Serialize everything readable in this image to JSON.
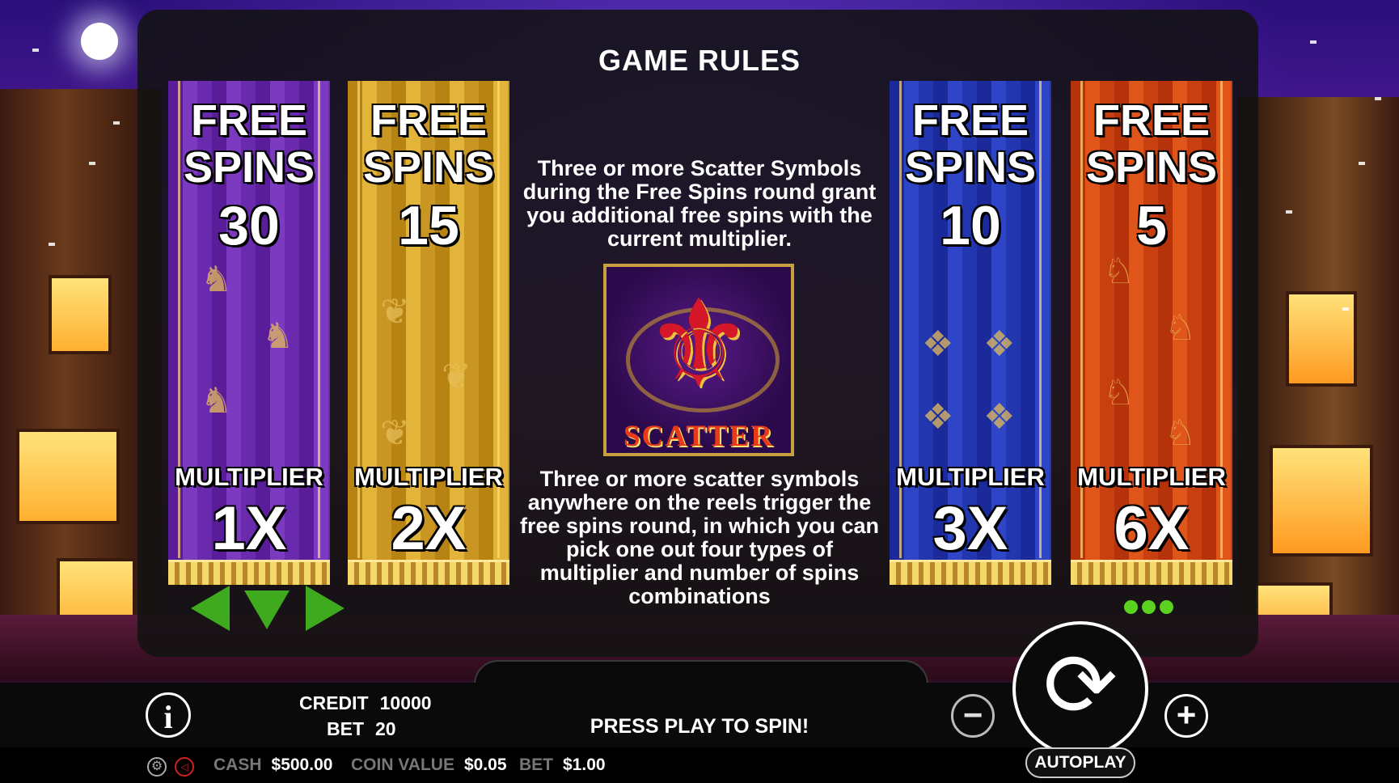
{
  "title": "GAME RULES",
  "banners": [
    {
      "free_line1": "FREE",
      "free_line2": "SPINS",
      "spins": "30",
      "mult_label": "MULTIPLIER",
      "mult": "1X",
      "motif": "lion-icon"
    },
    {
      "free_line1": "FREE",
      "free_line2": "SPINS",
      "spins": "15",
      "mult_label": "MULTIPLIER",
      "mult": "2X",
      "motif": "crest-icon"
    },
    {
      "free_line1": "FREE",
      "free_line2": "SPINS",
      "spins": "10",
      "mult_label": "MULTIPLIER",
      "mult": "3X",
      "motif": "eagle-icon"
    },
    {
      "free_line1": "FREE",
      "free_line2": "SPINS",
      "spins": "5",
      "mult_label": "MULTIPLIER",
      "mult": "6X",
      "motif": "horse-icon"
    }
  ],
  "rules": {
    "text_top": "Three or more Scatter Symbols during the Free Spins round grant you additional free spins with the current multiplier.",
    "scatter_label": "SCATTER",
    "text_bottom": "Three or more scatter symbols anywhere on the reels trigger the free spins round, in which you can pick one out four types of multiplier and number of spins combinations"
  },
  "nav": {
    "prev": "arrow-left-icon",
    "close": "arrow-down-icon",
    "next": "arrow-right-icon",
    "pages": 3
  },
  "hud": {
    "credit_label": "CREDIT",
    "credit_value": "10000",
    "bet_label": "BET",
    "bet_value": "20",
    "message": "PRESS PLAY TO SPIN!",
    "autoplay": "AUTOPLAY",
    "info": "i",
    "minus": "−",
    "plus": "+"
  },
  "status": {
    "cash_label": "CASH",
    "cash_value": "$500.00",
    "coin_label": "COIN VALUE",
    "coin_value": "$0.05",
    "bet_label": "BET",
    "bet_value": "$1.00"
  },
  "colors": {
    "accent_green": "#3faa1e",
    "dot_green": "#5bd21f",
    "purple": "#6a2aae",
    "gold": "#c99624",
    "blue": "#2236b0",
    "orange": "#c94010"
  }
}
